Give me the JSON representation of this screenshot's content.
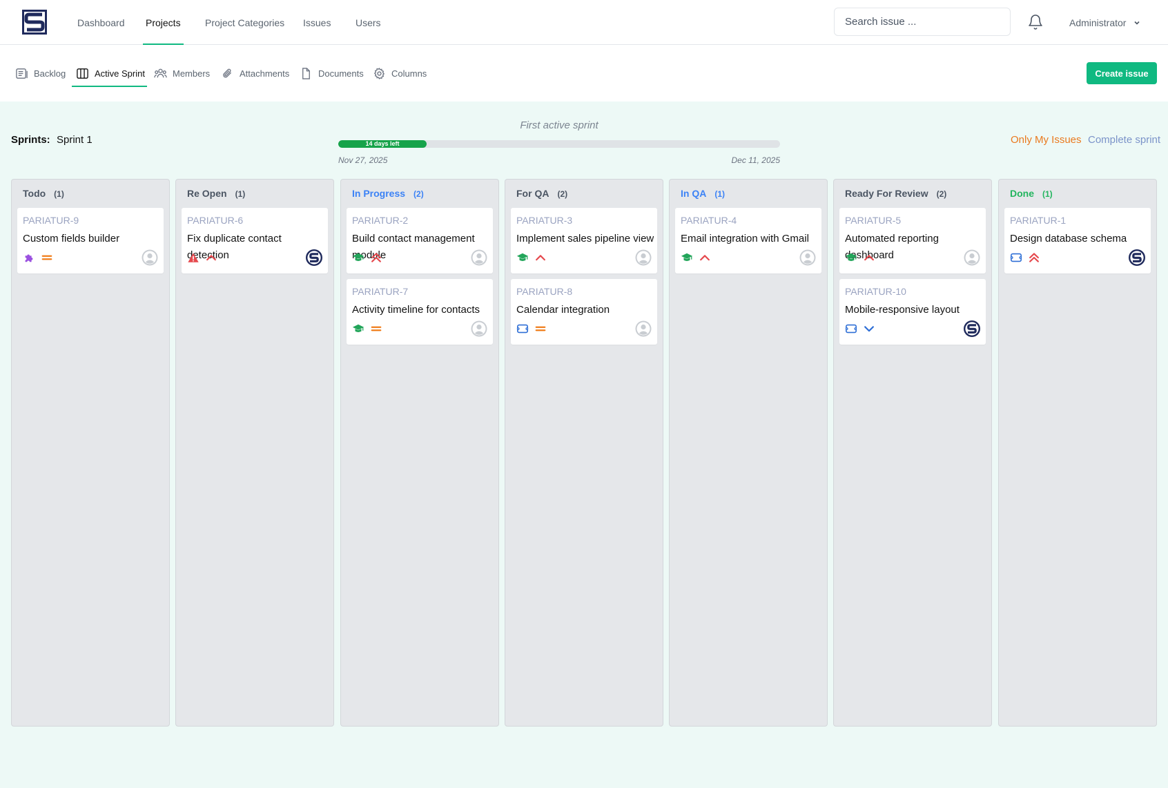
{
  "nav": {
    "links": [
      "Dashboard",
      "Projects",
      "Project Categories",
      "Issues",
      "Users"
    ],
    "search_placeholder": "Search issue ...",
    "user": "Administrator"
  },
  "subnav": {
    "tabs": [
      "Backlog",
      "Active Sprint",
      "Members",
      "Attachments",
      "Documents",
      "Columns"
    ],
    "create_label": "Create issue"
  },
  "sprint": {
    "label": "Sprints:",
    "name": "Sprint 1",
    "goal": "First active sprint",
    "days_left": "14 days left",
    "progress": 0.2,
    "start": "Nov 27, 2025",
    "end": "Dec 11, 2025",
    "only_mine": "Only My Issues",
    "complete": "Complete sprint"
  },
  "colors": {
    "accent": "#10b981",
    "link_orange": "#ea7a1f",
    "link_blue": "#7b93c9",
    "issue_key": "#9aa3c0"
  },
  "columns": [
    {
      "name": "Todo",
      "count": "(1)",
      "color": "#4b5563",
      "cards": [
        {
          "key": "PARIATUR-9",
          "title": "Custom fields builder",
          "type": "epic-icon",
          "priority": "priority-medium-icon",
          "assignee": "default-avatar-icon"
        }
      ]
    },
    {
      "name": "Re Open",
      "count": "(1)",
      "color": "#4b5563",
      "cards": [
        {
          "key": "PARIATUR-6",
          "title": "Fix duplicate contact detection",
          "type": "bug-icon",
          "priority": "priority-high-icon",
          "assignee": "admin-avatar-icon"
        }
      ]
    },
    {
      "name": "In Progress",
      "count": "(2)",
      "color": "#3b82f6",
      "cards": [
        {
          "key": "PARIATUR-2",
          "title": "Build contact management module",
          "type": "story-icon",
          "priority": "priority-highest-icon",
          "assignee": "default-avatar-icon"
        },
        {
          "key": "PARIATUR-7",
          "title": "Activity timeline for contacts",
          "type": "story-icon",
          "priority": "priority-medium-icon",
          "assignee": "default-avatar-icon"
        }
      ]
    },
    {
      "name": "For QA",
      "count": "(2)",
      "color": "#4b5563",
      "cards": [
        {
          "key": "PARIATUR-3",
          "title": "Implement sales pipeline view",
          "type": "story-icon",
          "priority": "priority-high-icon",
          "assignee": "default-avatar-icon"
        },
        {
          "key": "PARIATUR-8",
          "title": "Calendar integration",
          "type": "task-icon",
          "priority": "priority-medium-icon",
          "assignee": "default-avatar-icon"
        }
      ]
    },
    {
      "name": "In QA",
      "count": "(1)",
      "color": "#3b82f6",
      "cards": [
        {
          "key": "PARIATUR-4",
          "title": "Email integration with Gmail",
          "type": "story-icon",
          "priority": "priority-high-icon",
          "assignee": "default-avatar-icon"
        }
      ]
    },
    {
      "name": "Ready For Review",
      "count": "(2)",
      "color": "#4b5563",
      "cards": [
        {
          "key": "PARIATUR-5",
          "title": "Automated reporting dashboard",
          "type": "story-icon",
          "priority": "priority-high-icon",
          "assignee": "default-avatar-icon"
        },
        {
          "key": "PARIATUR-10",
          "title": "Mobile-responsive layout",
          "type": "task-icon",
          "priority": "priority-low-icon",
          "assignee": "admin-avatar-icon"
        }
      ]
    },
    {
      "name": "Done",
      "count": "(1)",
      "color": "#22b55e",
      "cards": [
        {
          "key": "PARIATUR-1",
          "title": "Design database schema",
          "type": "task-icon",
          "priority": "priority-highest-icon",
          "assignee": "admin-avatar-icon"
        }
      ]
    }
  ]
}
